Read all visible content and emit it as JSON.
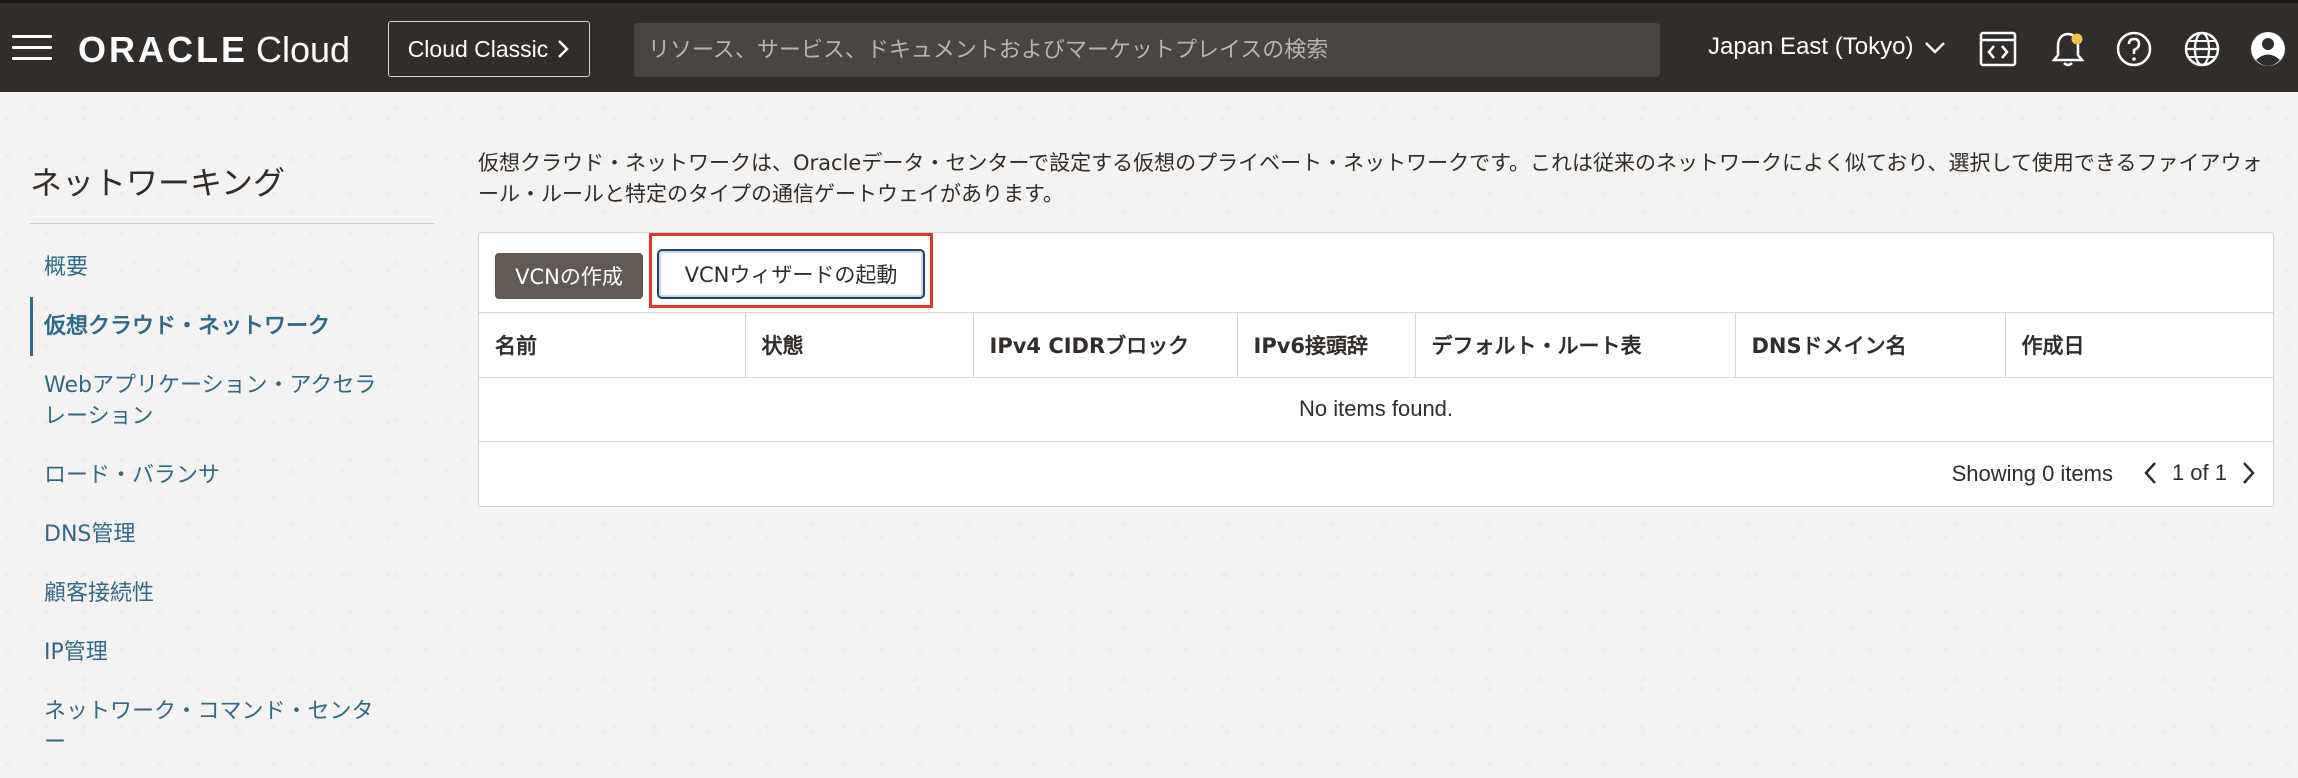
{
  "header": {
    "logo_brand": "ORACLE",
    "logo_product": "Cloud",
    "classic_button": "Cloud Classic",
    "search_placeholder": "リソース、サービス、ドキュメントおよびマーケットプレイスの検索",
    "region": "Japan East (Tokyo)"
  },
  "sidebar": {
    "title": "ネットワーキング",
    "items": [
      {
        "label": "概要"
      },
      {
        "label": "仮想クラウド・ネットワーク",
        "active": true
      },
      {
        "label": "Webアプリケーション・アクセラレーション"
      },
      {
        "label": "ロード・バランサ"
      },
      {
        "label": "DNS管理"
      },
      {
        "label": "顧客接続性"
      },
      {
        "label": "IP管理"
      },
      {
        "label": "ネットワーク・コマンド・センター"
      }
    ]
  },
  "main": {
    "description": "仮想クラウド・ネットワークは、Oracleデータ・センターで設定する仮想のプライベート・ネットワークです。これは従来のネットワークによく似ており、選択して使用できるファイアウォール・ルールと特定のタイプの通信ゲートウェイがあります。",
    "create_button": "VCNの作成",
    "wizard_button": "VCNウィザードの起動",
    "table": {
      "columns": [
        "名前",
        "状態",
        "IPv4 CIDRブロック",
        "IPv6接頭辞",
        "デフォルト・ルート表",
        "DNSドメイン名",
        "作成日"
      ],
      "empty_message": "No items found."
    },
    "footer": {
      "showing": "Showing 0 items",
      "page": "1 of 1"
    }
  },
  "colors": {
    "header_bg": "#312d2a",
    "link": "#2e6a8a",
    "highlight": "#e0382d"
  }
}
